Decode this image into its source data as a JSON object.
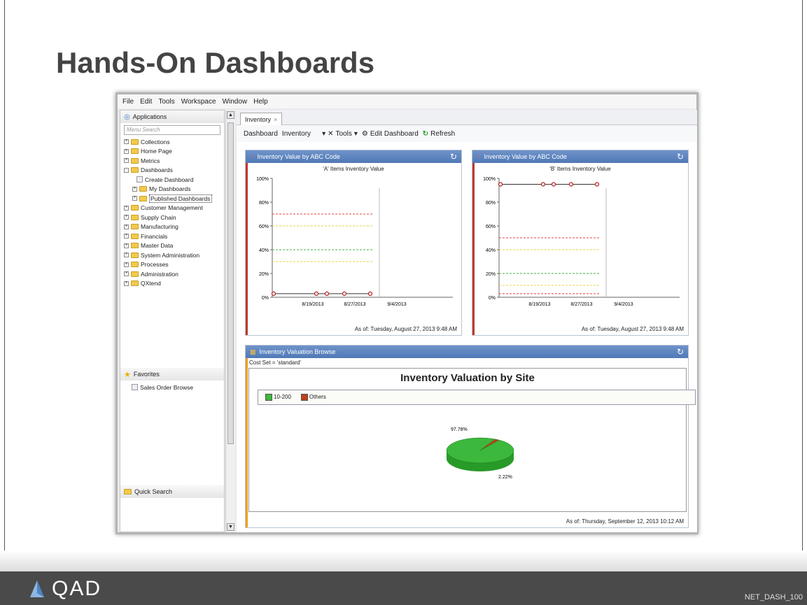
{
  "slide": {
    "title": "Hands-On Dashboards",
    "logo_text": "QAD",
    "code": "NET_DASH_100"
  },
  "menu": [
    "File",
    "Edit",
    "Tools",
    "Workspace",
    "Window",
    "Help"
  ],
  "applications": {
    "header": "Applications",
    "search_placeholder": "Menu Search",
    "tree": [
      {
        "label": "Collections",
        "level": 0,
        "expander": "+"
      },
      {
        "label": "Home Page",
        "level": 0,
        "expander": "+"
      },
      {
        "label": "Metrics",
        "level": 0,
        "expander": "+"
      },
      {
        "label": "Dashboards",
        "level": 0,
        "expander": "-"
      },
      {
        "label": "Create Dashboard",
        "level": 2,
        "expander": ""
      },
      {
        "label": "My Dashboards",
        "level": 1,
        "expander": "+"
      },
      {
        "label": "Published Dashboards",
        "level": 1,
        "expander": "+"
      },
      {
        "label": "Customer Management",
        "level": 0,
        "expander": "+"
      },
      {
        "label": "Supply Chain",
        "level": 0,
        "expander": "+"
      },
      {
        "label": "Manufacturing",
        "level": 0,
        "expander": "+"
      },
      {
        "label": "Financials",
        "level": 0,
        "expander": "+"
      },
      {
        "label": "Master Data",
        "level": 0,
        "expander": "+"
      },
      {
        "label": "System Administration",
        "level": 0,
        "expander": "+"
      },
      {
        "label": "Processes",
        "level": 0,
        "expander": "+"
      },
      {
        "label": "Administration",
        "level": 0,
        "expander": "+"
      },
      {
        "label": "QXtend",
        "level": 0,
        "expander": "+"
      }
    ]
  },
  "favorites": {
    "header": "Favorites",
    "items": [
      "Sales Order Browse"
    ]
  },
  "quick_search": {
    "header": "Quick Search"
  },
  "tab": {
    "label": "Inventory",
    "close": "×"
  },
  "toolbar": {
    "dashboard": "Dashboard",
    "inventory": "Inventory",
    "tools": "Tools",
    "edit_dashboard": "Edit Dashboard",
    "refresh": "Refresh"
  },
  "panels": {
    "a": {
      "title": "Inventory Value by ABC Code",
      "subtitle": "'A' Items Inventory Value",
      "asof": "As of: Tuesday, August 27, 2013 9:48 AM"
    },
    "b": {
      "title": "Inventory Value by ABC Code",
      "subtitle": "'B' Items Inventory Value",
      "asof": "As of: Tuesday, August 27, 2013 9:48 AM"
    },
    "c": {
      "title": "Inventory Valuation Browse",
      "filter": "Cost Set = 'standard'",
      "asof": "As of: Thursday, September 12, 2013 10:12 AM"
    }
  },
  "chart_data": [
    {
      "type": "line",
      "title": "'A' Items Inventory Value",
      "yticks": [
        "0%",
        "20%",
        "40%",
        "60%",
        "80%",
        "100%"
      ],
      "xticks": [
        "8/19/2013",
        "8/27/2013",
        "9/4/2013"
      ],
      "ylim": [
        0,
        100
      ],
      "series": [
        {
          "values": [
            3,
            3,
            3,
            3,
            3
          ]
        }
      ],
      "thresholds": [
        {
          "value": 70,
          "color": "#e84040"
        },
        {
          "value": 60,
          "color": "#e8d040"
        },
        {
          "value": 40,
          "color": "#40b040"
        },
        {
          "value": 30,
          "color": "#e8d040"
        }
      ]
    },
    {
      "type": "line",
      "title": "'B' Items Inventory Value",
      "yticks": [
        "0%",
        "20%",
        "40%",
        "60%",
        "80%",
        "100%"
      ],
      "xticks": [
        "8/19/2013",
        "8/27/2013",
        "9/4/2013"
      ],
      "ylim": [
        0,
        100
      ],
      "series": [
        {
          "values": [
            95,
            95,
            95,
            95,
            95
          ]
        }
      ],
      "thresholds": [
        {
          "value": 50,
          "color": "#e84040"
        },
        {
          "value": 40,
          "color": "#e8d040"
        },
        {
          "value": 20,
          "color": "#40b040"
        },
        {
          "value": 10,
          "color": "#e8d040"
        },
        {
          "value": 3,
          "color": "#e84040"
        }
      ]
    },
    {
      "type": "pie",
      "title": "Inventory Valuation by Site",
      "series": [
        {
          "name": "10-200",
          "value": 97.78,
          "label": "97.78%",
          "color": "#3cb83c"
        },
        {
          "name": "Others",
          "value": 2.22,
          "label": "2.22%",
          "color": "#c0401c"
        }
      ]
    }
  ]
}
